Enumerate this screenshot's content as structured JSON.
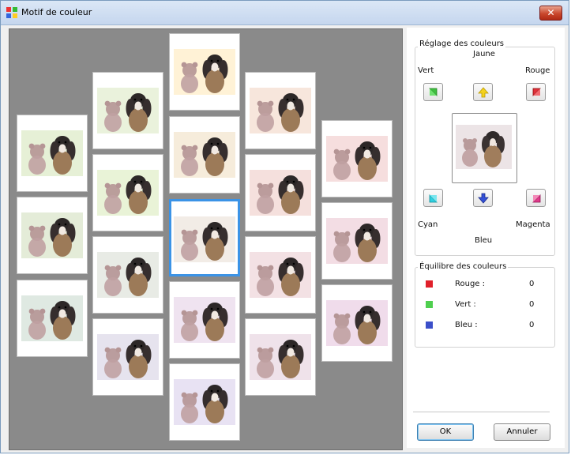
{
  "window": {
    "title": "Motif de couleur",
    "close_icon": "close-icon"
  },
  "preview": {
    "thumbnails": [
      {
        "tint": "#e6f0d6"
      },
      {
        "tint": "#e4ecd8"
      },
      {
        "tint": "#dfe9e2"
      },
      {
        "tint": "#eaf2dc"
      },
      {
        "tint": "#e9f3d7"
      },
      {
        "tint": "#e8ebe5"
      },
      {
        "tint": "#e6e3ee"
      },
      {
        "tint": "#fff2d6"
      },
      {
        "tint": "#f6ecdb"
      },
      {
        "tint": "#f2ece6"
      },
      {
        "tint": "#efe3f0"
      },
      {
        "tint": "#e8e2f3"
      },
      {
        "tint": "#f7e6dc"
      },
      {
        "tint": "#f5e0dd"
      },
      {
        "tint": "#f3e1e4"
      },
      {
        "tint": "#efe2ea"
      },
      {
        "tint": "#f6dede"
      },
      {
        "tint": "#f3dde4"
      },
      {
        "tint": "#f0dceb"
      }
    ],
    "selected_index": 9
  },
  "color_adjust": {
    "group_label": "Réglage des couleurs",
    "yellow": "Jaune",
    "green": "Vert",
    "red": "Rouge",
    "cyan": "Cyan",
    "magenta": "Magenta",
    "blue": "Bleu"
  },
  "balance": {
    "group_label": "Équilibre des couleurs",
    "red_label": "Rouge :",
    "green_label": "Vert :",
    "blue_label": "Bleu :",
    "red_value": "0",
    "green_value": "0",
    "blue_value": "0",
    "red_color": "#e0202a",
    "green_color": "#4fcf4f",
    "blue_color": "#3b4fc9"
  },
  "buttons": {
    "ok": "OK",
    "cancel": "Annuler"
  },
  "colors": {
    "selection": "#3b93e6",
    "background": "#8a8a8a"
  }
}
